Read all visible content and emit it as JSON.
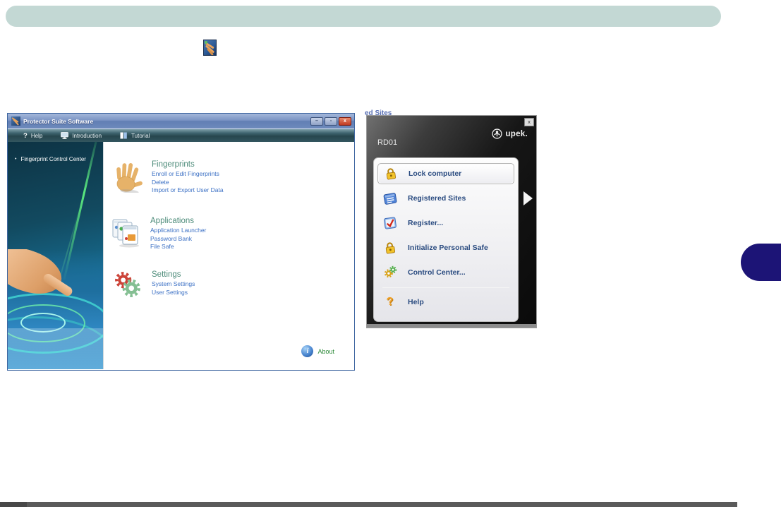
{
  "doc": {
    "inline_icon": "fingerprint-app-icon"
  },
  "left_window": {
    "title": "Protector Suite Software",
    "window_buttons": {
      "minimize": "–",
      "maximize": "▫",
      "close": "x"
    },
    "menubar": {
      "help": "Help",
      "help_glyph": "?",
      "introduction": "Introduction",
      "tutorial": "Tutorial"
    },
    "sidebar": {
      "bullet": "•",
      "item": "Fingerprint Control Center"
    },
    "sections": [
      {
        "title": "Fingerprints",
        "icon": "hand-icon",
        "links": [
          "Enroll or Edit Fingerprints",
          "Delete",
          "Import or Export User Data"
        ]
      },
      {
        "title": "Applications",
        "icon": "application-windows-icon",
        "links": [
          "Application Launcher",
          "Password Bank",
          "File Safe"
        ]
      },
      {
        "title": "Settings",
        "icon": "gears-icon",
        "links": [
          "System Settings",
          "User Settings"
        ]
      }
    ],
    "about_label": "About"
  },
  "right_window": {
    "backdrop_fragment": "ed Sites",
    "close_glyph": "x",
    "brand": "upek.",
    "user_label": "RD01",
    "menu_items": [
      {
        "label": "Lock computer",
        "icon": "lock-icon",
        "highlighted": true
      },
      {
        "label": "Registered Sites",
        "icon": "registered-sites-icon",
        "highlighted": false
      },
      {
        "label": "Register...",
        "icon": "register-check-icon",
        "highlighted": false
      },
      {
        "label": "Initialize Personal Safe",
        "icon": "lock-icon",
        "highlighted": false
      },
      {
        "label": "Control Center...",
        "icon": "control-gears-icon",
        "highlighted": false
      },
      {
        "label": "Help",
        "icon": "help-question-icon",
        "highlighted": false
      }
    ],
    "help_glyph": "?"
  },
  "colors": {
    "header_bar": "#c3d8d4",
    "chapter_tab": "#1c1476",
    "footer_bar": "#5a5a5a",
    "section_title_green": "#4e8c7a",
    "link_blue": "#3a6fc4",
    "about_green": "#2e8b3a",
    "menu_label_navy": "#2a4b80",
    "titlebar_blue": "#6d8abc"
  }
}
